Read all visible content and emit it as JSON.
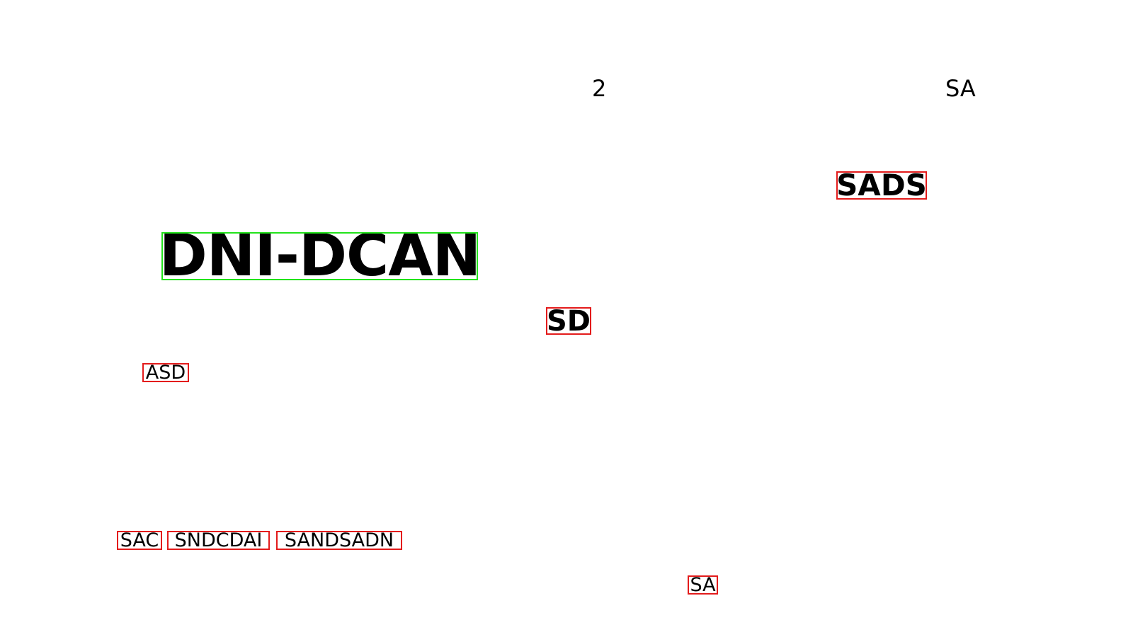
{
  "labels": {
    "top_number": "2",
    "top_right": "SA",
    "sads": "SADS",
    "main_title": "DNI-DCAN",
    "sd": "SD",
    "asd": "ASD",
    "sac": "SAC",
    "sndcdai": "SNDCDAI",
    "sandsadn": "SANDSADN",
    "bottom_sa": "SA"
  },
  "colors": {
    "highlight_box": "#e31b1b",
    "primary_box": "#22e31b",
    "text": "#000000",
    "background": "#ffffff"
  }
}
